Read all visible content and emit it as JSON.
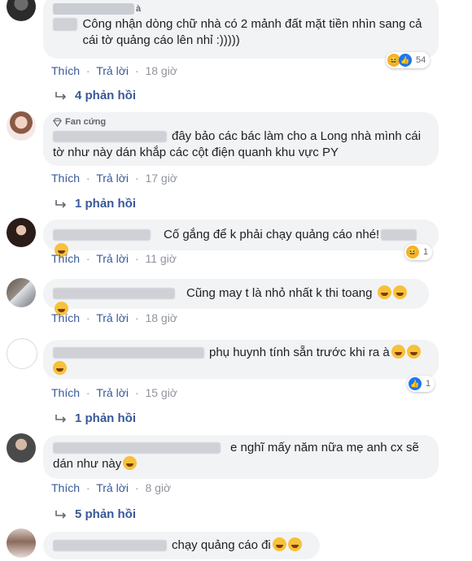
{
  "comments": [
    {
      "text": "Công nhận dòng chữ nhà có 2 mảnh đất mặt tiền nhìn sang cả cái tờ quảng cáo lên nhỉ :)))))",
      "name_partial": "à",
      "reaction_count": "54",
      "time": "18 giờ",
      "replies": "4 phản hồi"
    },
    {
      "badge": "Fan cứng",
      "text": "đây bảo các bác làm cho a Long nhà mình cái tờ như này dán khắp các cột điện quanh khu vực PY",
      "time": "17 giờ",
      "replies": "1 phản hồi"
    },
    {
      "text": "Cố gắng để k phải chạy quảng cáo nhé!",
      "reaction_count": "1",
      "time": "11 giờ"
    },
    {
      "text": "Cũng may t là nhỏ nhất k thi toang",
      "time": "18 giờ"
    },
    {
      "text": "phụ huynh tính sẵn trước khi ra à",
      "reaction_count": "1",
      "time": "15 giờ",
      "replies": "1 phản hồi"
    },
    {
      "text": "e nghĩ mấy năm nữa mẹ anh cx sẽ dán như này",
      "time": "8 giờ",
      "replies": "5 phản hồi"
    },
    {
      "text": "chạy quảng cáo đi"
    }
  ],
  "actions": {
    "like": "Thích",
    "reply": "Trả lời",
    "sep": "·"
  },
  "colors": {
    "link": "#385898",
    "bubble": "#f2f3f5",
    "meta": "#90949c",
    "like_blue": "#1877f2",
    "haha": "#f7b125"
  }
}
